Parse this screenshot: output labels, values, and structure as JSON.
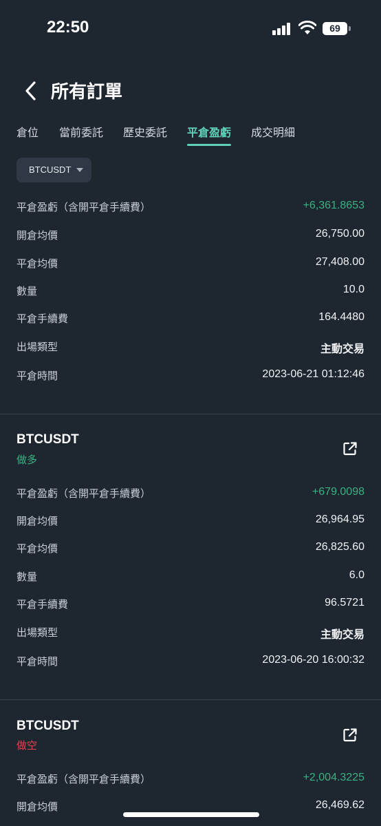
{
  "status_bar": {
    "time": "22:50",
    "battery": "69"
  },
  "header": {
    "title": "所有訂單"
  },
  "tabs": [
    {
      "label": "倉位"
    },
    {
      "label": "當前委託"
    },
    {
      "label": "歷史委託"
    },
    {
      "label": "平倉盈虧",
      "active": true
    },
    {
      "label": "成交明細"
    }
  ],
  "filter": {
    "symbol": "BTCUSDT"
  },
  "labels": {
    "pnl": "平倉盈虧（含開平倉手續費）",
    "open_avg": "開倉均價",
    "close_avg": "平倉均價",
    "qty": "數量",
    "close_fee": "平倉手續費",
    "exit_type": "出場類型",
    "close_time": "平倉時間"
  },
  "records": [
    {
      "pnl": "+6,361.8653",
      "open_avg": "26,750.00",
      "close_avg": "27,408.00",
      "qty": "10.0",
      "close_fee": "164.4480",
      "exit_type": "主動交易",
      "close_time": "2023-06-21 01:12:46"
    },
    {
      "symbol": "BTCUSDT",
      "side": "做多",
      "pnl": "+679.0098",
      "open_avg": "26,964.95",
      "close_avg": "26,825.60",
      "qty": "6.0",
      "close_fee": "96.5721",
      "exit_type": "主動交易",
      "close_time": "2023-06-20 16:00:32"
    },
    {
      "symbol": "BTCUSDT",
      "side": "做空",
      "pnl": "+2,004.3225",
      "open_avg": "26,469.62"
    }
  ],
  "colors": {
    "background": "#1e2630",
    "accent": "#5fd1b9",
    "profit": "#39b281",
    "short": "#e0474f"
  }
}
